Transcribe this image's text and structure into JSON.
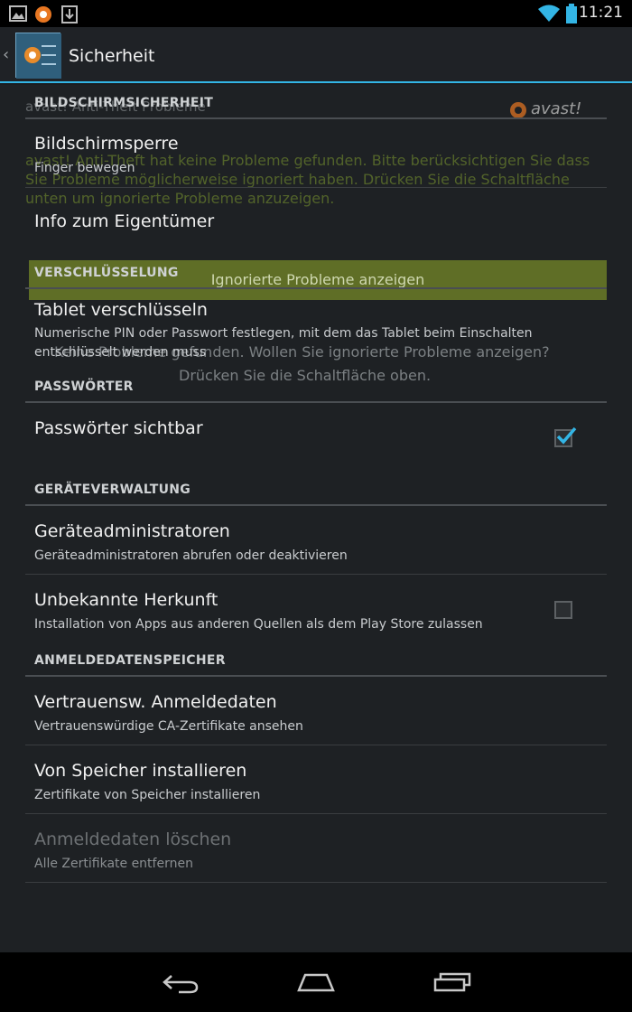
{
  "status_bar": {
    "time": "11:21",
    "icons": [
      "gallery-icon",
      "avast-notification-icon",
      "download-icon",
      "wifi-icon",
      "battery-icon"
    ]
  },
  "action_bar": {
    "title": "Sicherheit",
    "icon": "avast-app-icon",
    "accent": "#33b5e5"
  },
  "sections": {
    "screen_security": "BILDSCHIRMSICHERHEIT",
    "encryption": "VERSCHLÜSSELUNG",
    "passwords": "PASSWÖRTER",
    "device_admin": "GERÄTEVERWALTUNG",
    "credential_storage": "ANMELDEDATENSPEICHER"
  },
  "prefs": {
    "screen_lock": {
      "title": "Bildschirmsperre",
      "summary": "Finger bewegen"
    },
    "owner_info": {
      "title": "Info zum Eigentümer"
    },
    "encrypt_tablet": {
      "title": "Tablet verschlüsseln",
      "summary": "Numerische PIN oder Passwort festlegen, mit dem das Tablet beim Einschalten entschlüsselt werden muss"
    },
    "show_passwords": {
      "title": "Passwörter sichtbar",
      "checked": true
    },
    "device_admins": {
      "title": "Geräteadministratoren",
      "summary": "Geräteadministratoren abrufen oder deaktivieren"
    },
    "unknown_sources": {
      "title": "Unbekannte Herkunft",
      "summary": "Installation von Apps aus anderen Quellen als dem Play Store zulassen",
      "checked": false
    },
    "trusted_credentials": {
      "title": "Vertrauensw. Anmeldedaten",
      "summary": "Vertrauenswürdige CA-Zertifikate ansehen"
    },
    "install_from_storage": {
      "title": "Von Speicher installieren",
      "summary": "Zertifikate von Speicher installieren"
    },
    "clear_credentials": {
      "title": "Anmeldedaten löschen",
      "summary": "Alle Zertifikate entfernen",
      "enabled": false
    }
  },
  "avast_overlay": {
    "logo": "avast!",
    "heading": "avast! Anti-Theft Probleme",
    "message": "avast! Anti-Theft hat keine Probleme gefunden. Bitte berücksichtigen Sie dass Sie Probleme möglicherweise ignoriert haben. Drücken Sie die Schaltfläche unten um ignorierte Probleme anzuzeigen.",
    "button": "Ignorierte Probleme anzeigen",
    "info_line1": "Keine Probleme gefunden. Wollen Sie ignorierte Probleme anzeigen?",
    "info_line2": "Drücken Sie die Schaltfläche oben."
  },
  "nav_bar": {
    "buttons": [
      "back-icon",
      "home-icon",
      "recent-apps-icon"
    ]
  }
}
